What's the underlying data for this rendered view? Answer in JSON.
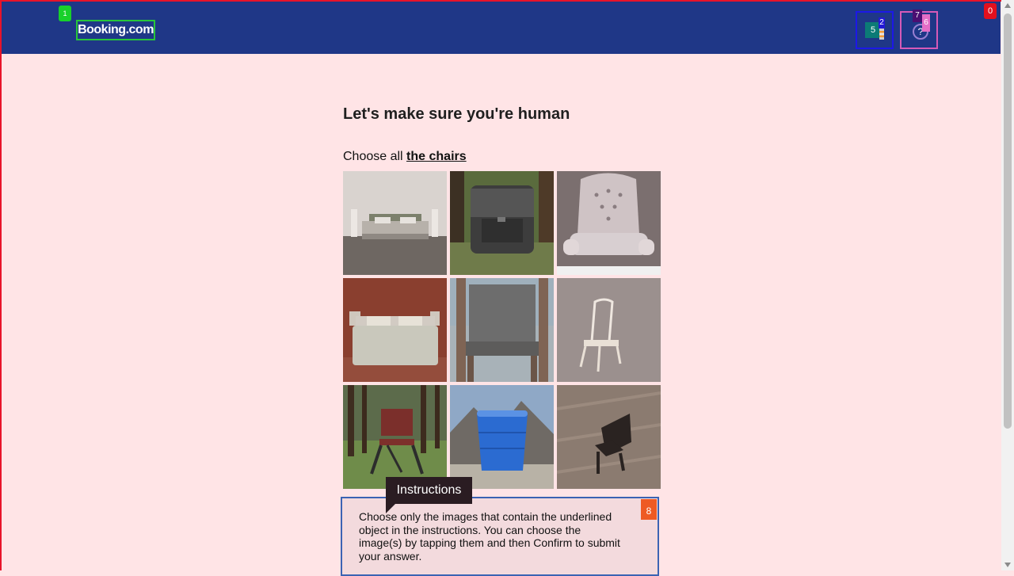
{
  "header": {
    "logo": "Booking.com",
    "currency_icon": "currency-icon",
    "currency_text": "5",
    "help_icon": "help-icon",
    "help_text": "?"
  },
  "badges": {
    "b0": "0",
    "b1": "1",
    "b2": "2",
    "b5": "5",
    "b6": "6",
    "b7": "7",
    "b8": "8"
  },
  "main": {
    "heading": "Let's make sure you're human",
    "prompt_prefix": "Choose all ",
    "prompt_target": "the chairs"
  },
  "tiles": [
    {
      "subject": "bed"
    },
    {
      "subject": "backpack"
    },
    {
      "subject": "armchair"
    },
    {
      "subject": "bed"
    },
    {
      "subject": "chair"
    },
    {
      "subject": "chair"
    },
    {
      "subject": "chair"
    },
    {
      "subject": "bucket"
    },
    {
      "subject": "chair"
    }
  ],
  "instructions": {
    "title": "Instructions",
    "text": "Choose only the images that contain the underlined object in the instructions. You can choose the image(s) by tapping them and then Confirm to submit your answer."
  },
  "colors": {
    "header_bg": "#1f3787",
    "page_bg": "#ffe4e6",
    "accent_border": "#3b63b3",
    "badge_red": "#e3101e"
  }
}
